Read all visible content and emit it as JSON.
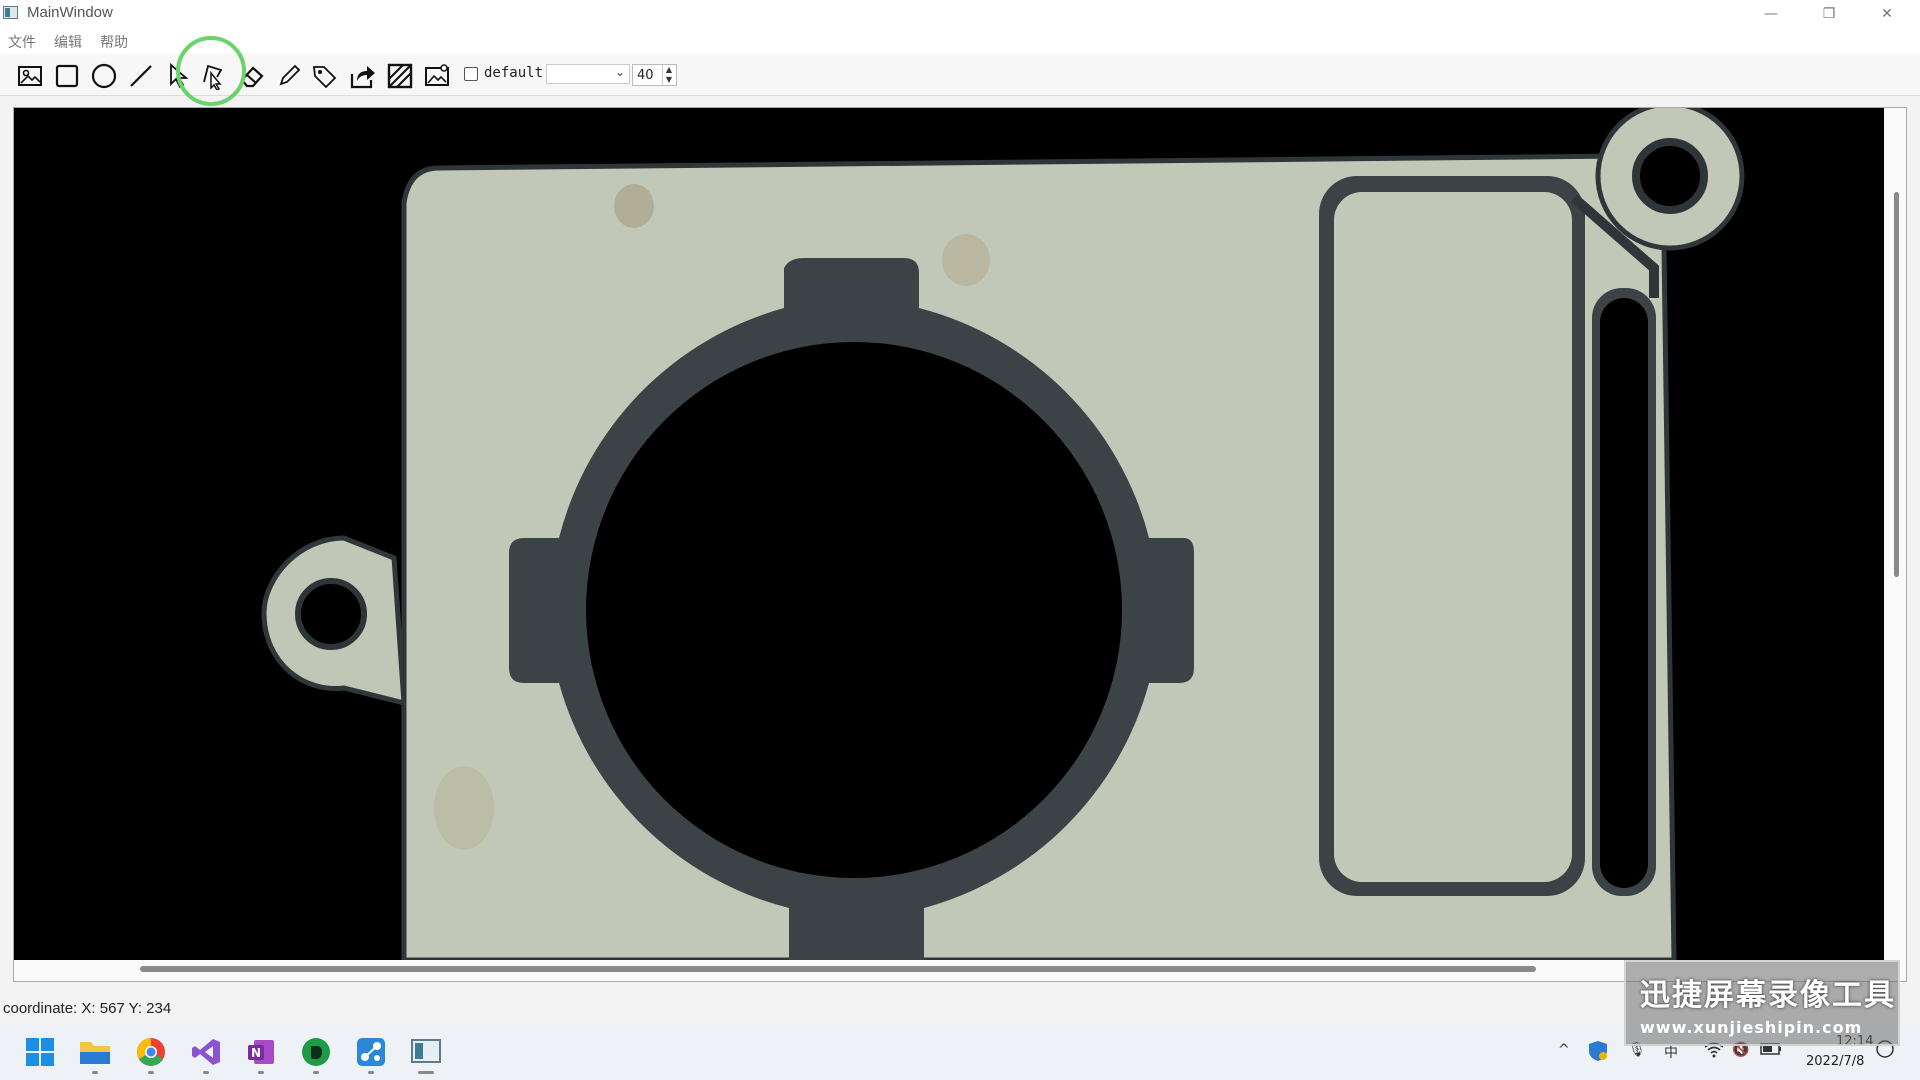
{
  "window": {
    "title": "MainWindow",
    "controls": {
      "minimize": "—",
      "restore": "❐",
      "close": "✕"
    }
  },
  "menu": {
    "items": [
      "文件",
      "编辑",
      "帮助"
    ]
  },
  "toolbar": {
    "tools": [
      "open-image-icon",
      "rectangle-icon",
      "circle-icon",
      "line-icon",
      "pointer-icon",
      "polygon-pointer-icon",
      "eraser-icon",
      "pencil-icon",
      "tag-icon",
      "export-icon",
      "hatch-icon",
      "image-settings-icon"
    ],
    "active_tool": "polygon-pointer-icon",
    "label_checkbox": {
      "label": "default",
      "checked": false
    },
    "class_combo": {
      "value": ""
    },
    "size_spin": {
      "value": "40"
    }
  },
  "status": {
    "coordinate": "coordinate: X: 567 Y: 234"
  },
  "taskbar": {
    "apps": [
      "windows-start-icon",
      "file-explorer-icon",
      "chrome-icon",
      "visual-studio-icon",
      "onenote-icon",
      "evernote-icon",
      "network-app-icon",
      "main-window-app-icon"
    ],
    "tray": {
      "chevron": "^",
      "ime": "中",
      "time": "12:14",
      "date": "2022/7/8"
    }
  },
  "watermark": {
    "title": "迅捷屏幕录像工具",
    "url": "www.xunjieshipin.com"
  },
  "colors": {
    "canvas_bg": "#000000",
    "part": "#c2c8b7",
    "recess": "#3b4347",
    "highlight": "#6bd36b"
  }
}
